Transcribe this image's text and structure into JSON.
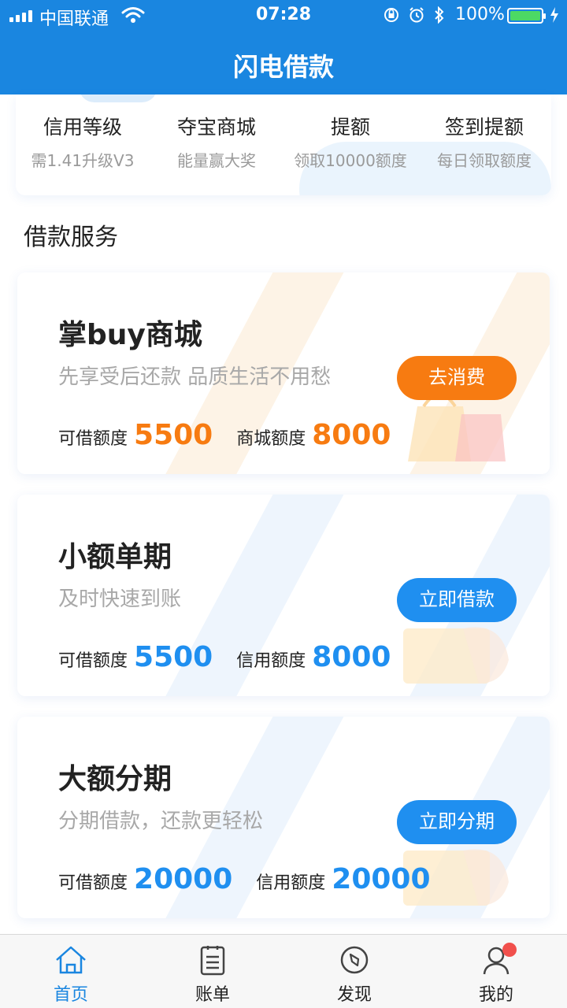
{
  "status_bar": {
    "carrier": "中国联通",
    "time": "07:28",
    "battery": "100%",
    "icons": [
      "signal-icon",
      "wifi-icon",
      "orientation-lock-icon",
      "alarm-icon",
      "bluetooth-icon",
      "battery-icon",
      "charging-icon"
    ]
  },
  "header": {
    "title": "闪电借款"
  },
  "quick_entries": [
    {
      "title": "信用等级",
      "subtitle": "需1.41升级V3"
    },
    {
      "title": "夺宝商城",
      "subtitle": "能量赢大奖"
    },
    {
      "title": "提额",
      "subtitle": "领取10000额度"
    },
    {
      "title": "签到提额",
      "subtitle": "每日领取额度"
    }
  ],
  "section": {
    "title": "借款服务"
  },
  "loan_cards": [
    {
      "name": "掌buy商城",
      "desc": "先享受后还款 品质生活不用愁",
      "button": "去消费",
      "quota1_label": "可借额度",
      "quota1_value": "5500",
      "quota2_label": "商城额度",
      "quota2_value": "8000",
      "accent": "#f77b11"
    },
    {
      "name": "小额单期",
      "desc": "及时快速到账",
      "button": "立即借款",
      "quota1_label": "可借额度",
      "quota1_value": "5500",
      "quota2_label": "信用额度",
      "quota2_value": "8000",
      "accent": "#1f8ff0"
    },
    {
      "name": "大额分期",
      "desc": "分期借款，还款更轻松",
      "button": "立即分期",
      "quota1_label": "可借额度",
      "quota1_value": "20000",
      "quota2_label": "信用额度",
      "quota2_value": "20000",
      "accent": "#1f8ff0"
    }
  ],
  "tabbar": {
    "tabs": [
      {
        "label": "首页",
        "icon": "home-icon",
        "active": true
      },
      {
        "label": "账单",
        "icon": "bill-icon",
        "active": false
      },
      {
        "label": "发现",
        "icon": "compass-icon",
        "active": false
      },
      {
        "label": "我的",
        "icon": "user-icon",
        "active": false,
        "badge": true
      }
    ],
    "active_color": "#1a86e0",
    "badge_color": "#f1504c"
  },
  "colors": {
    "brand_blue": "#1a86e0",
    "orange": "#f77b11",
    "blue": "#1f8ff0"
  }
}
